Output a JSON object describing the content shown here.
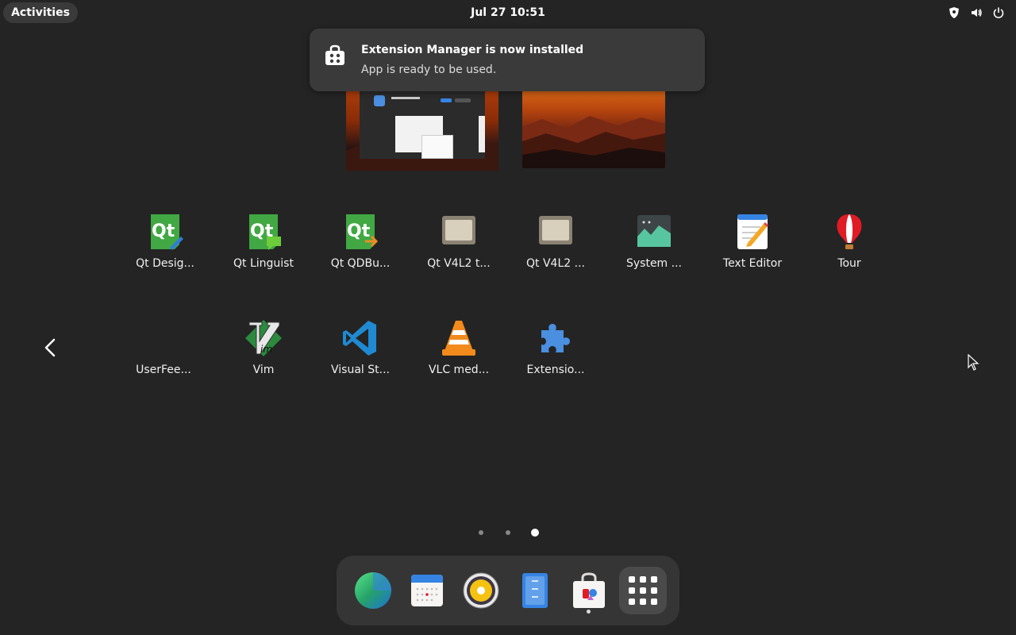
{
  "topbar": {
    "activities_label": "Activities",
    "clock": "Jul 27  10:51",
    "tray_icons": [
      "security-shield-icon",
      "volume-icon",
      "power-icon"
    ]
  },
  "notification": {
    "icon": "software-store-icon",
    "title": "Extension Manager is now installed",
    "body": "App is ready to be used."
  },
  "workspaces": [
    {
      "name": "workspace-1",
      "preview": "Extension Manager window"
    },
    {
      "name": "workspace-2",
      "preview": "wallpaper"
    }
  ],
  "apps": [
    {
      "label": "Qt Desig...",
      "icon": "qt-designer-icon"
    },
    {
      "label": "Qt Linguist",
      "icon": "qt-linguist-icon"
    },
    {
      "label": "Qt QDBu...",
      "icon": "qt-qdbus-icon"
    },
    {
      "label": "Qt V4L2 t...",
      "icon": "qt-v4l2-test-icon"
    },
    {
      "label": "Qt V4L2 ...",
      "icon": "qt-v4l2-icon"
    },
    {
      "label": "System ...",
      "icon": "system-monitor-icon"
    },
    {
      "label": "Text Editor",
      "icon": "text-editor-icon"
    },
    {
      "label": "Tour",
      "icon": "tour-balloon-icon"
    },
    {
      "label": "UserFee...",
      "icon": "user-feedback-icon"
    },
    {
      "label": "Vim",
      "icon": "vim-icon"
    },
    {
      "label": "Visual St...",
      "icon": "vscode-icon"
    },
    {
      "label": "VLC med...",
      "icon": "vlc-icon"
    },
    {
      "label": "Extensio...",
      "icon": "extension-puzzle-icon"
    }
  ],
  "pager": {
    "pages": 3,
    "current": 3
  },
  "dock": [
    {
      "name": "browser",
      "icon": "globe-browser-icon",
      "running": false
    },
    {
      "name": "calendar",
      "icon": "calendar-icon",
      "running": false
    },
    {
      "name": "rhythmbox",
      "icon": "speaker-music-icon",
      "running": false
    },
    {
      "name": "files",
      "icon": "files-icon",
      "running": false
    },
    {
      "name": "software",
      "icon": "software-store-icon",
      "running": true
    },
    {
      "name": "show-apps",
      "icon": "app-grid-icon",
      "running": false,
      "active": true
    }
  ],
  "colors": {
    "background": "#242424",
    "panel": "#3a3a3a",
    "dock": "#353535",
    "accent": "#3584e4"
  }
}
